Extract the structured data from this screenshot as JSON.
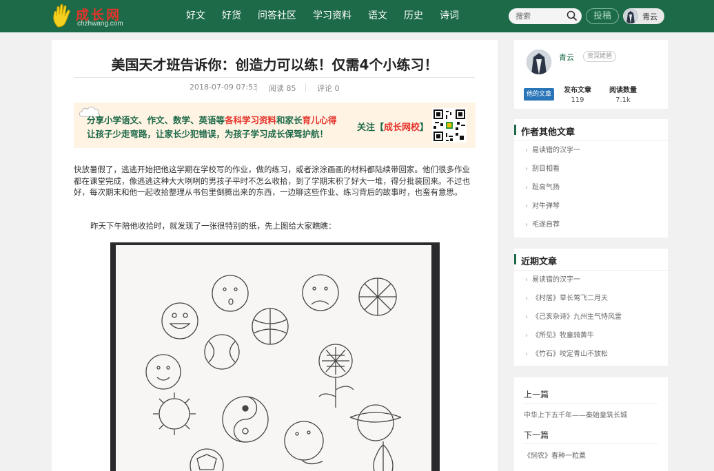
{
  "header": {
    "logo_cn": "成长网",
    "logo_en": "chzhwang.com",
    "nav": [
      "好文",
      "好货",
      "问答社区",
      "学习资料",
      "语文",
      "历史",
      "诗词"
    ],
    "search_placeholder": "搜索",
    "contribute_label": "投稿",
    "user_name": "青云"
  },
  "article": {
    "title": "美国天才班告诉你：创造力可以练！仅需4个小练习！",
    "date": "2018-07-09 07:53",
    "views": "阅读 85",
    "comments": "评论 0",
    "banner": {
      "line1_a": "分享小学语文、作文、数学、英语等",
      "line1_b": "各科学习资料",
      "line1_c": "和家长",
      "line1_d": "育儿心得",
      "line2": "让孩子少走弯路，让家长少犯错误，为孩子学习成长保驾护航！",
      "follow_a": "关注【",
      "follow_b": "成长网校",
      "follow_c": "】"
    },
    "paragraph1": "快放暑假了，逃逃开始把他这学期在学校写的作业，做的练习，或者涂涂画画的材料都陆续带回家。他们很多作业都在课堂完成，像逃逃这种大大咧咧的男孩子平时不怎么收拾，到了学期末积了好大一堆，得分批装回来。不过也好，每次期末和他一起收拾整理从书包里倒腾出来的东西，一边聊这些作业、练习背后的故事时，也蛮有意思。",
    "paragraph2": "昨天下午陪他收拾时，就发现了一张很特别的纸，先上图给大家瞧瞧："
  },
  "sidebar": {
    "author": {
      "name": "青云",
      "badge": "资深姥爸",
      "tag": "他的文章",
      "posts_label": "发布文章",
      "posts_value": "119",
      "reads_label": "阅读数量",
      "reads_value": "7.1k"
    },
    "other_title": "作者其他文章",
    "other_items": [
      "易读错的汉字一",
      "刮目相看",
      "趾高气扬",
      "对牛弹琴",
      "毛遂自荐"
    ],
    "recent_title": "近期文章",
    "recent_items": [
      "易读错的汉字一",
      "《村居》草长莺飞二月天",
      "《己亥杂诗》九州生气恃风雷",
      "《所见》牧童骑黄牛",
      "《竹石》咬定青山不放松"
    ],
    "prev_label": "上一篇",
    "prev_link": "中华上下五千年——秦始皇筑长城",
    "next_label": "下一篇",
    "next_link": "《悯农》春种一粒粟"
  }
}
